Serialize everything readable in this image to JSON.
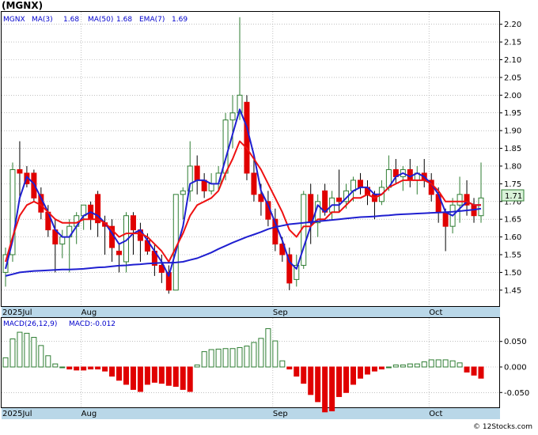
{
  "header": {
    "ticker_title": "(MGNX)",
    "legend_ticker": "MGNX",
    "ma3_label": "MA(3)",
    "ma3_value": "1.68",
    "ma50_label": "MA(50)",
    "ma50_value": "1.68",
    "ema7_label": "EMA(7)",
    "ema7_value": "1.69",
    "current_price_tag": "1.71",
    "macd_label": "MACD(26,12,9)",
    "macd_value_label": "MACD:-0.012",
    "watermark": "© 12Stocks.com"
  },
  "colors": {
    "up_candle": "#2e7d32",
    "down_candle": "#e00000",
    "ma_blue": "#1f1fd0",
    "ema_red": "#ee1111",
    "axis_band": "#b9d7e8",
    "price_tag_bg": "#d9f2d9"
  },
  "chart_data": [
    {
      "type": "candlestick",
      "title": "(MGNX)",
      "ylim": [
        1.405,
        2.235
      ],
      "yticks": [
        "2.20",
        "2.15",
        "2.10",
        "2.05",
        "2.00",
        "1.95",
        "1.90",
        "1.85",
        "1.80",
        "1.75",
        "1.70",
        "1.65",
        "1.60",
        "1.55",
        "1.50",
        "1.45"
      ],
      "x_labels": [
        "2025Jul",
        "Aug",
        "Sep",
        "Oct"
      ],
      "x_label_index": [
        0,
        11,
        38,
        60
      ],
      "grid": true,
      "ohlc": [
        [
          1.5,
          1.57,
          1.46,
          1.55
        ],
        [
          1.55,
          1.81,
          1.53,
          1.79
        ],
        [
          1.79,
          1.87,
          1.7,
          1.78
        ],
        [
          1.78,
          1.8,
          1.74,
          1.75
        ],
        [
          1.78,
          1.79,
          1.7,
          1.71
        ],
        [
          1.72,
          1.74,
          1.65,
          1.67
        ],
        [
          1.67,
          1.69,
          1.6,
          1.62
        ],
        [
          1.62,
          1.65,
          1.5,
          1.58
        ],
        [
          1.58,
          1.62,
          1.54,
          1.6
        ],
        [
          1.6,
          1.65,
          1.5,
          1.63
        ],
        [
          1.63,
          1.67,
          1.58,
          1.66
        ],
        [
          1.66,
          1.69,
          1.62,
          1.69
        ],
        [
          1.69,
          1.7,
          1.62,
          1.65
        ],
        [
          1.72,
          1.73,
          1.6,
          1.64
        ],
        [
          1.64,
          1.66,
          1.55,
          1.63
        ],
        [
          1.63,
          1.65,
          1.53,
          1.57
        ],
        [
          1.56,
          1.58,
          1.5,
          1.55
        ],
        [
          1.53,
          1.67,
          1.5,
          1.66
        ],
        [
          1.66,
          1.67,
          1.55,
          1.62
        ],
        [
          1.62,
          1.64,
          1.53,
          1.59
        ],
        [
          1.59,
          1.61,
          1.55,
          1.56
        ],
        [
          1.56,
          1.58,
          1.49,
          1.52
        ],
        [
          1.52,
          1.55,
          1.47,
          1.5
        ],
        [
          1.5,
          1.52,
          1.44,
          1.45
        ],
        [
          1.45,
          1.72,
          1.45,
          1.72
        ],
        [
          1.72,
          1.74,
          1.65,
          1.73
        ],
        [
          1.73,
          1.87,
          1.7,
          1.8
        ],
        [
          1.8,
          1.83,
          1.72,
          1.76
        ],
        [
          1.76,
          1.78,
          1.71,
          1.73
        ],
        [
          1.73,
          1.78,
          1.72,
          1.75
        ],
        [
          1.75,
          1.8,
          1.73,
          1.78
        ],
        [
          1.78,
          1.95,
          1.76,
          1.93
        ],
        [
          1.93,
          2.0,
          1.85,
          1.95
        ],
        [
          1.95,
          2.22,
          1.93,
          2.0
        ],
        [
          1.98,
          2.0,
          1.76,
          1.78
        ],
        [
          1.78,
          1.82,
          1.7,
          1.72
        ],
        [
          1.72,
          1.75,
          1.66,
          1.7
        ],
        [
          1.7,
          1.73,
          1.63,
          1.65
        ],
        [
          1.65,
          1.68,
          1.56,
          1.58
        ],
        [
          1.58,
          1.6,
          1.53,
          1.55
        ],
        [
          1.55,
          1.57,
          1.45,
          1.47
        ],
        [
          1.48,
          1.55,
          1.46,
          1.52
        ],
        [
          1.52,
          1.73,
          1.51,
          1.72
        ],
        [
          1.72,
          1.75,
          1.58,
          1.64
        ],
        [
          1.64,
          1.72,
          1.6,
          1.7
        ],
        [
          1.73,
          1.75,
          1.66,
          1.67
        ],
        [
          1.67,
          1.73,
          1.65,
          1.71
        ],
        [
          1.71,
          1.79,
          1.67,
          1.7
        ],
        [
          1.7,
          1.75,
          1.68,
          1.73
        ],
        [
          1.73,
          1.77,
          1.7,
          1.76
        ],
        [
          1.76,
          1.78,
          1.72,
          1.74
        ],
        [
          1.74,
          1.76,
          1.69,
          1.72
        ],
        [
          1.72,
          1.73,
          1.65,
          1.7
        ],
        [
          1.7,
          1.76,
          1.69,
          1.74
        ],
        [
          1.74,
          1.83,
          1.73,
          1.79
        ],
        [
          1.79,
          1.82,
          1.75,
          1.77
        ],
        [
          1.77,
          1.8,
          1.73,
          1.79
        ],
        [
          1.79,
          1.82,
          1.74,
          1.76
        ],
        [
          1.76,
          1.8,
          1.72,
          1.78
        ],
        [
          1.78,
          1.82,
          1.74,
          1.76
        ],
        [
          1.76,
          1.78,
          1.7,
          1.72
        ],
        [
          1.72,
          1.74,
          1.64,
          1.67
        ],
        [
          1.67,
          1.68,
          1.56,
          1.63
        ],
        [
          1.63,
          1.71,
          1.61,
          1.69
        ],
        [
          1.69,
          1.77,
          1.64,
          1.72
        ],
        [
          1.72,
          1.76,
          1.66,
          1.69
        ],
        [
          1.69,
          1.71,
          1.64,
          1.66
        ],
        [
          1.66,
          1.81,
          1.64,
          1.71
        ]
      ],
      "series": [
        {
          "name": "MA(3)",
          "values": [
            1.51,
            1.59,
            1.71,
            1.77,
            1.75,
            1.71,
            1.67,
            1.62,
            1.6,
            1.6,
            1.63,
            1.66,
            1.67,
            1.66,
            1.64,
            1.61,
            1.58,
            1.59,
            1.61,
            1.62,
            1.59,
            1.56,
            1.53,
            1.49,
            1.56,
            1.63,
            1.75,
            1.76,
            1.76,
            1.75,
            1.75,
            1.82,
            1.89,
            1.96,
            1.91,
            1.83,
            1.73,
            1.69,
            1.64,
            1.59,
            1.53,
            1.51,
            1.57,
            1.63,
            1.69,
            1.67,
            1.69,
            1.69,
            1.71,
            1.73,
            1.74,
            1.74,
            1.72,
            1.72,
            1.74,
            1.77,
            1.78,
            1.77,
            1.78,
            1.77,
            1.75,
            1.72,
            1.67,
            1.66,
            1.68,
            1.7,
            1.69,
            1.69
          ]
        },
        {
          "name": "EMA(7)",
          "values": [
            1.53,
            1.6,
            1.66,
            1.69,
            1.7,
            1.69,
            1.67,
            1.65,
            1.64,
            1.64,
            1.64,
            1.65,
            1.65,
            1.65,
            1.64,
            1.62,
            1.6,
            1.61,
            1.61,
            1.61,
            1.6,
            1.58,
            1.56,
            1.53,
            1.57,
            1.61,
            1.66,
            1.69,
            1.7,
            1.71,
            1.73,
            1.78,
            1.82,
            1.87,
            1.85,
            1.82,
            1.79,
            1.75,
            1.71,
            1.67,
            1.62,
            1.6,
            1.63,
            1.63,
            1.65,
            1.65,
            1.67,
            1.67,
            1.69,
            1.71,
            1.71,
            1.72,
            1.71,
            1.72,
            1.74,
            1.75,
            1.76,
            1.76,
            1.76,
            1.76,
            1.75,
            1.73,
            1.7,
            1.7,
            1.7,
            1.7,
            1.69,
            1.69
          ]
        },
        {
          "name": "MA(50)",
          "values": [
            1.49,
            1.495,
            1.5,
            1.502,
            1.504,
            1.505,
            1.506,
            1.507,
            1.508,
            1.508,
            1.509,
            1.51,
            1.512,
            1.514,
            1.515,
            1.517,
            1.519,
            1.52,
            1.522,
            1.523,
            1.525,
            1.526,
            1.527,
            1.527,
            1.528,
            1.53,
            1.535,
            1.54,
            1.548,
            1.556,
            1.566,
            1.575,
            1.584,
            1.592,
            1.6,
            1.607,
            1.614,
            1.622,
            1.628,
            1.632,
            1.636,
            1.638,
            1.64,
            1.642,
            1.644,
            1.646,
            1.648,
            1.65,
            1.652,
            1.654,
            1.656,
            1.657,
            1.658,
            1.66,
            1.661,
            1.663,
            1.664,
            1.665,
            1.666,
            1.667,
            1.668,
            1.669,
            1.67,
            1.671,
            1.673,
            1.675,
            1.677,
            1.68
          ]
        }
      ]
    },
    {
      "type": "bar",
      "title": "MACD(26,12,9)",
      "ylim": [
        -0.079,
        0.096
      ],
      "yticks": [
        "0.050",
        "0.000",
        "-0.050"
      ],
      "x_labels": [
        "2025Jul",
        "Aug",
        "Sep",
        "Oct"
      ],
      "x_label_index": [
        0,
        11,
        38,
        60
      ],
      "series": [
        {
          "name": "MACD",
          "values": [
            0.018,
            0.055,
            0.068,
            0.066,
            0.058,
            0.042,
            0.022,
            0.006,
            0.0,
            -0.004,
            -0.006,
            -0.006,
            -0.004,
            -0.004,
            -0.008,
            -0.018,
            -0.026,
            -0.034,
            -0.044,
            -0.048,
            -0.034,
            -0.03,
            -0.032,
            -0.036,
            -0.038,
            -0.044,
            -0.048,
            0.004,
            0.03,
            0.034,
            0.035,
            0.036,
            0.036,
            0.038,
            0.041,
            0.048,
            0.056,
            0.075,
            0.051,
            0.012,
            -0.004,
            -0.018,
            -0.032,
            -0.054,
            -0.068,
            -0.088,
            -0.086,
            -0.058,
            -0.05,
            -0.034,
            -0.022,
            -0.014,
            -0.008,
            -0.004,
            0.0,
            0.004,
            0.004,
            0.006,
            0.006,
            0.01,
            0.014,
            0.014,
            0.014,
            0.012,
            0.008,
            -0.01,
            -0.016,
            -0.022
          ]
        }
      ]
    }
  ]
}
